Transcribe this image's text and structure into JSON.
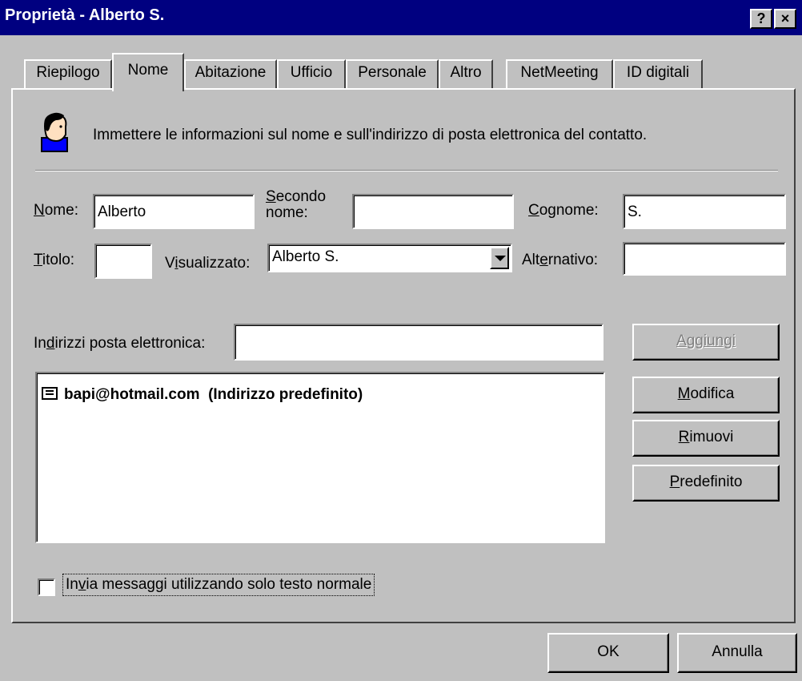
{
  "window": {
    "title": "Proprietà - Alberto S.",
    "help_label": "?",
    "close_label": "×"
  },
  "tabs": [
    {
      "label": "Riepilogo"
    },
    {
      "label": "Nome",
      "active": true
    },
    {
      "label": "Abitazione"
    },
    {
      "label": "Ufficio"
    },
    {
      "label": "Personale"
    },
    {
      "label": "Altro"
    },
    {
      "label": "NetMeeting"
    },
    {
      "label": "ID digitali"
    }
  ],
  "header": {
    "icon": "contact-person-icon",
    "text": "Immettere le informazioni sul nome e sull'indirizzo di posta elettronica del contatto."
  },
  "fields": {
    "nome": {
      "label_mnemonic": "N",
      "label_rest": "ome:",
      "value": "Alberto"
    },
    "secondo_nome": {
      "label_mnemonic": "S",
      "label_rest1": "econdo",
      "label_line2": "nome:",
      "value": ""
    },
    "cognome": {
      "label_mnemonic": "C",
      "label_rest": "ognome:",
      "value": "S."
    },
    "titolo": {
      "label_mnemonic": "T",
      "label_rest": "itolo:",
      "value": ""
    },
    "visualizzato": {
      "label_pre": "V",
      "label_mnemonic": "i",
      "label_rest": "sualizzato:",
      "value": "Alberto S."
    },
    "alternativo": {
      "label_pre": "Alt",
      "label_mnemonic": "e",
      "label_rest": "rnativo:",
      "value": ""
    }
  },
  "email": {
    "label_pre": "In",
    "label_mnemonic": "d",
    "label_rest": "irizzi posta elettronica:",
    "input_value": "",
    "list": [
      {
        "icon": "envelope-icon",
        "address": "bapi@hotmail.com",
        "note": "(Indirizzo predefinito)"
      }
    ]
  },
  "buttons": {
    "aggiungi": {
      "mnemonic": "A",
      "rest": "ggiungi",
      "disabled": true
    },
    "modifica": {
      "mnemonic": "M",
      "rest": "odifica"
    },
    "rimuovi": {
      "mnemonic": "R",
      "rest": "imuovi"
    },
    "predefinito": {
      "mnemonic": "P",
      "rest": "redefinito"
    },
    "ok": "OK",
    "annulla": "Annulla"
  },
  "checkbox": {
    "label_pre": "In",
    "label_mnemonic": "v",
    "label_rest": "ia messaggi utilizzando solo testo normale",
    "checked": false
  }
}
